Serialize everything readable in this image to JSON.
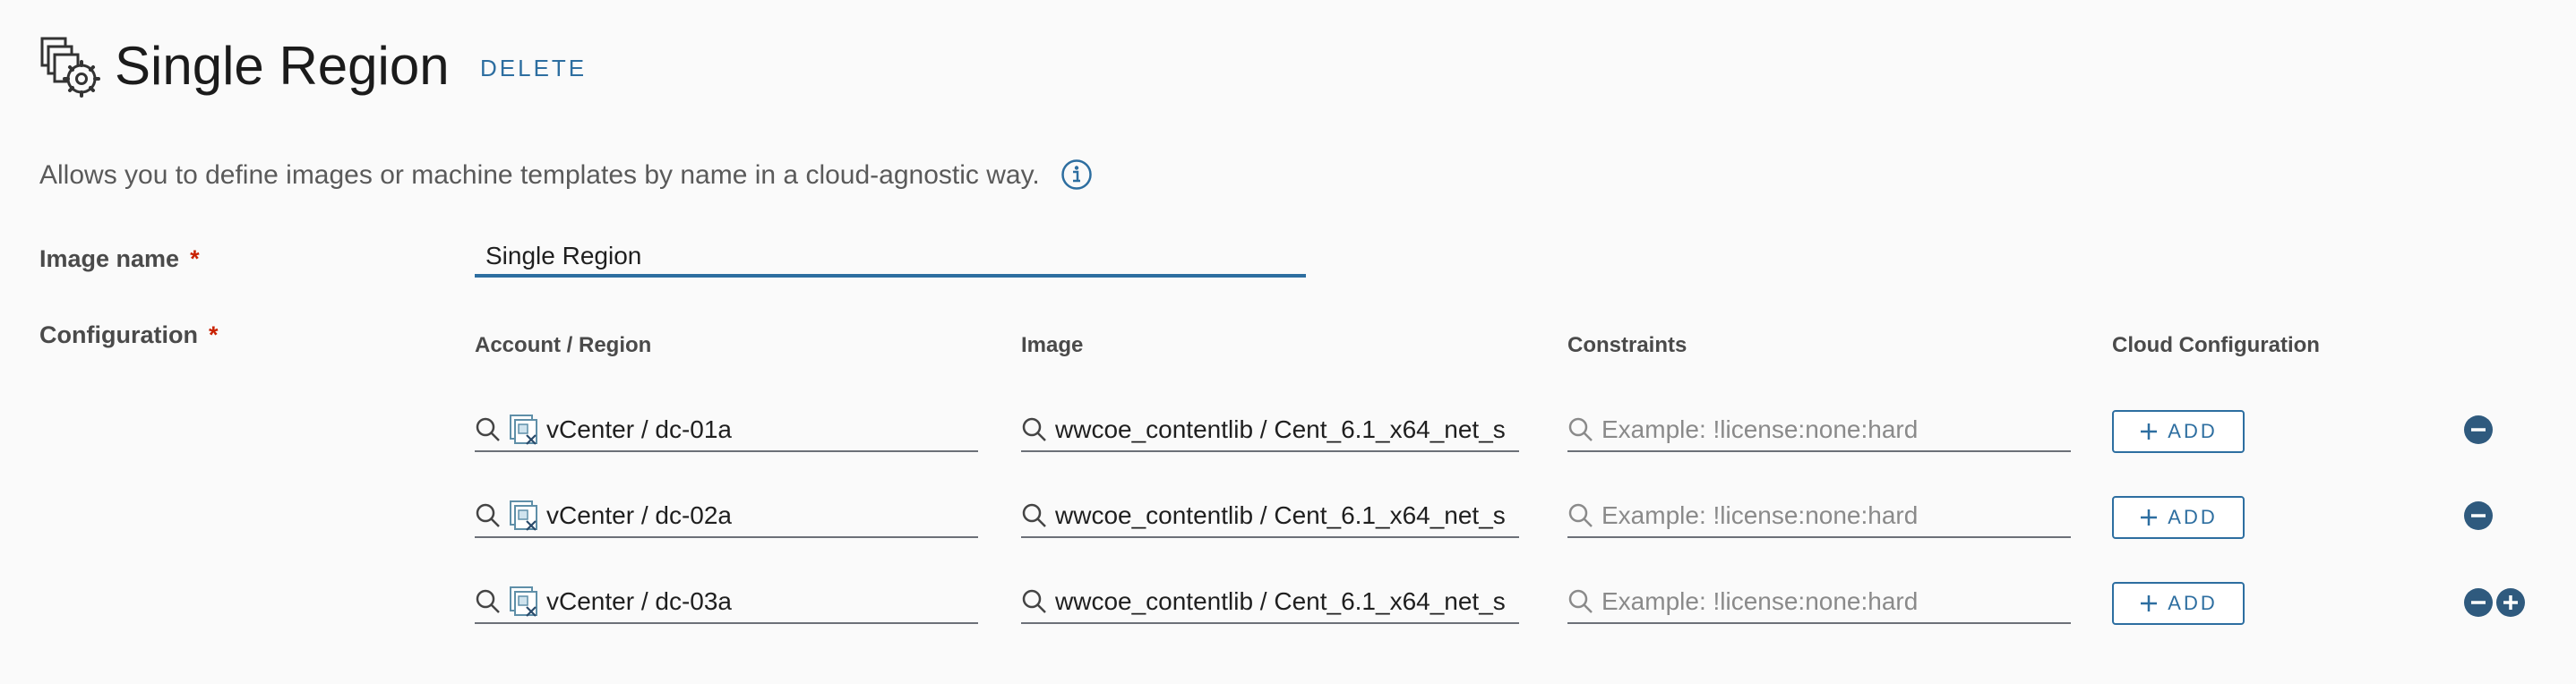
{
  "header": {
    "title": "Single Region",
    "delete_label": "DELETE"
  },
  "description": "Allows you to define images or machine templates by name in a cloud-agnostic way.",
  "form": {
    "image_name_label": "Image name",
    "image_name_value": "Single Region",
    "configuration_label": "Configuration",
    "required_marker": "*"
  },
  "table": {
    "columns": [
      "Account / Region",
      "Image",
      "Constraints",
      "Cloud Configuration"
    ],
    "rows": [
      {
        "account_region": "vCenter / dc-01a",
        "image": "wwcoe_contentlib / Cent_6.1_x64_net_s",
        "constraints_placeholder": "Example: !license:none:hard",
        "add_label": "ADD"
      },
      {
        "account_region": "vCenter / dc-02a",
        "image": "wwcoe_contentlib / Cent_6.1_x64_net_s",
        "constraints_placeholder": "Example: !license:none:hard",
        "add_label": "ADD"
      },
      {
        "account_region": "vCenter / dc-03a",
        "image": "wwcoe_contentlib / Cent_6.1_x64_net_s",
        "constraints_placeholder": "Example: !license:none:hard",
        "add_label": "ADD"
      }
    ]
  },
  "icons": {
    "header": "image-profile-gear-icon",
    "info": "info-circle-icon",
    "search": "search-icon",
    "account": "vcenter-account-icon",
    "add": "plus-icon",
    "remove_row": "minus-circle-icon",
    "add_row": "plus-circle-icon"
  },
  "colors": {
    "accent": "#2d6ea0",
    "required": "#c92100",
    "round_button": "#2f5a7e"
  }
}
